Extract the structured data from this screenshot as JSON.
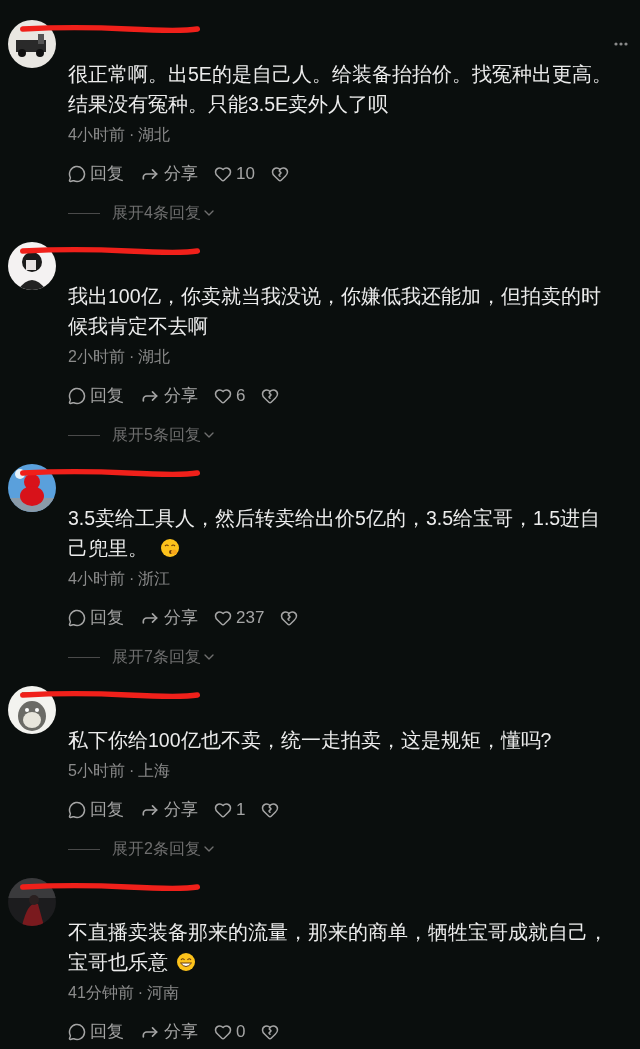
{
  "comments": [
    {
      "kind": "plain",
      "text": "很正常啊。出5E的是自己人。给装备抬抬价。找冤种出更高。结果没有冤种。只能3.5E卖外人了呗",
      "more_button": true,
      "time": "4小时前",
      "separator": "·",
      "location": "湖北",
      "reply": "回复",
      "share": "分享",
      "likes": "10",
      "expand": "展开4条回复"
    },
    {
      "kind": "plain",
      "text": "我出100亿，你卖就当我没说，你嫌低我还能加，但拍卖的时候我肯定不去啊",
      "more_button": false,
      "time": "2小时前",
      "separator": "·",
      "location": "湖北",
      "reply": "回复",
      "share": "分享",
      "likes": "6",
      "expand": "展开5条回复"
    },
    {
      "kind": "shush",
      "text": "3.5卖给工具人，然后转卖给出价5亿的，3.5给宝哥，1.5进自己兜里。",
      "more_button": false,
      "time": "4小时前",
      "separator": "·",
      "location": "浙江",
      "reply": "回复",
      "share": "分享",
      "likes": "237",
      "expand": "展开7条回复"
    },
    {
      "kind": "plain",
      "text": "私下你给100亿也不卖，统一走拍卖，这是规矩，懂吗?",
      "more_button": false,
      "time": "5小时前",
      "separator": "·",
      "location": "上海",
      "reply": "回复",
      "share": "分享",
      "likes": "1",
      "expand": "展开2条回复"
    },
    {
      "kind": "grin",
      "text": "不直播卖装备那来的流量，那来的商单，牺牲宝哥成就自己，宝哥也乐意",
      "more_button": false,
      "time": "41分钟前",
      "separator": "·",
      "location": "河南",
      "reply": "回复",
      "share": "分享",
      "likes": "0"
    }
  ]
}
